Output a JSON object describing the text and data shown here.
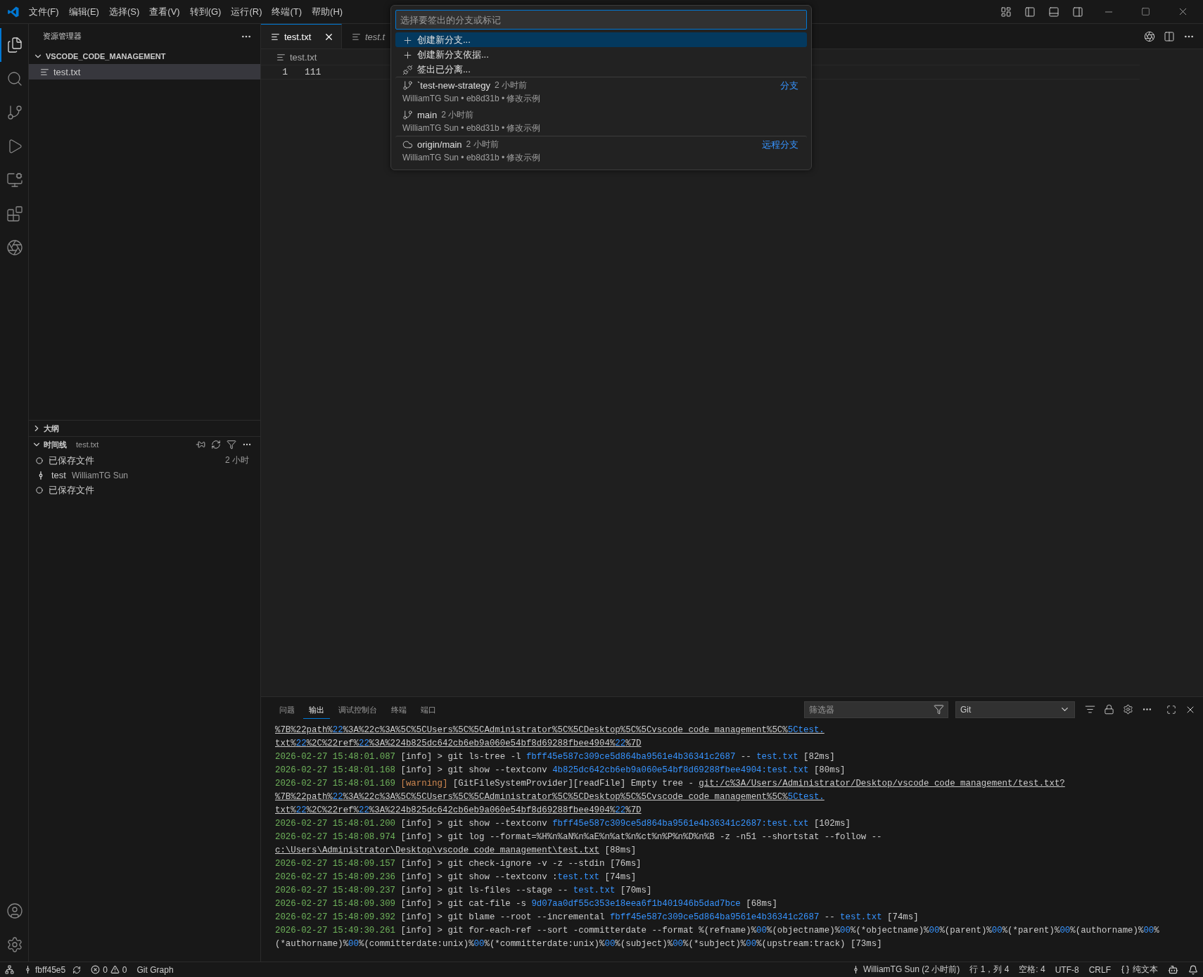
{
  "menu_bar": {
    "items": [
      "文件(F)",
      "编辑(E)",
      "选择(S)",
      "查看(V)",
      "转到(G)",
      "运行(R)",
      "终端(T)",
      "帮助(H)"
    ]
  },
  "activity_bar": {
    "items": [
      {
        "kind": "explorer",
        "selected": true
      },
      {
        "kind": "search",
        "selected": false
      },
      {
        "kind": "scm",
        "selected": false
      },
      {
        "kind": "debug",
        "selected": false
      },
      {
        "kind": "remote",
        "selected": false
      },
      {
        "kind": "extensions",
        "selected": false
      },
      {
        "kind": "assistant",
        "selected": false
      }
    ],
    "bottom": [
      {
        "kind": "account"
      },
      {
        "kind": "settings"
      }
    ]
  },
  "sidebar": {
    "title": "资源管理器",
    "folder": {
      "name": "VSCODE_CODE_MANAGEMENT",
      "expanded": true,
      "files": [
        {
          "name": "test.txt",
          "selected": true
        }
      ]
    },
    "sections": [
      {
        "title": "大纲",
        "expanded": false
      },
      {
        "title": "时间线",
        "subtitle": "test.txt",
        "expanded": true,
        "items": [
          {
            "kind": "save",
            "label": "已保存文件",
            "time": "2 小时"
          },
          {
            "kind": "commit",
            "label": "test",
            "author": "WilliamTG Sun"
          },
          {
            "kind": "save",
            "label": "已保存文件"
          }
        ]
      }
    ]
  },
  "editor": {
    "tabs": [
      {
        "label": "test.txt",
        "selected": true
      },
      {
        "label": "test.t",
        "selected": false
      }
    ],
    "breadcrumb": "test.txt",
    "lines": [
      {
        "number": "1",
        "text": "111"
      }
    ]
  },
  "quick_pick": {
    "placeholder": "选择要签出的分支或标记",
    "items": [
      {
        "kind": "create",
        "label": "创建新分支...",
        "selected": true
      },
      {
        "kind": "create",
        "label": "创建新分支依据...",
        "selected": false
      },
      {
        "kind": "detach",
        "label": "签出已分离...",
        "selected": false
      },
      {
        "kind": "branch",
        "label": "`test-new-strategy",
        "time": "2 小时前",
        "detail": "WilliamTG Sun • eb8d31b • 修改示例",
        "group": "分支",
        "selected": false
      },
      {
        "kind": "branch",
        "label": "main",
        "time": "2 小时前",
        "detail": "WilliamTG Sun • eb8d31b • 修改示例",
        "selected": false
      },
      {
        "kind": "remote",
        "label": "origin/main",
        "time": "2 小时前",
        "detail": "WilliamTG Sun • eb8d31b • 修改示例",
        "group": "远程分支",
        "selected": false
      }
    ]
  },
  "panel": {
    "tabs": [
      {
        "label": "问题",
        "selected": false
      },
      {
        "label": "输出",
        "selected": true
      },
      {
        "label": "调试控制台",
        "selected": false
      },
      {
        "label": "终端",
        "selected": false
      },
      {
        "label": "端口",
        "selected": false
      }
    ],
    "filter": {
      "placeholder": "筛选器"
    },
    "channel": "Git",
    "lines": [
      [
        {
          "kind": "link",
          "text": "%7B%22path%"
        },
        {
          "kind": "linkhash",
          "text": "22"
        },
        {
          "kind": "link",
          "text": "%3A%22c%3A%5C%5CUsers%5C%5CAdministrator%5C%5CDesktop%5C%5Cvscode_code_management%5C%"
        },
        {
          "kind": "linkhash",
          "text": "5Ctest."
        }
      ],
      [
        {
          "kind": "link",
          "text": "txt%"
        },
        {
          "kind": "linkhash",
          "text": "22"
        },
        {
          "kind": "link",
          "text": "%2C%22ref%"
        },
        {
          "kind": "linkhash",
          "text": "22"
        },
        {
          "kind": "link",
          "text": "%3A%224b825dc642cb6eb9a060e54bf8d69288fbee4904%"
        },
        {
          "kind": "linkhash",
          "text": "22"
        },
        {
          "kind": "link",
          "text": "%7D"
        }
      ],
      [
        {
          "kind": "time",
          "text": "2026-02-27 15:48:01.087"
        },
        {
          "kind": "tag",
          "text": " [info]"
        },
        {
          "kind": "plain",
          "text": " > git ls-tree -l "
        },
        {
          "kind": "hash",
          "text": "fbff45e587c309ce5d864ba9561e4b36341c2687"
        },
        {
          "kind": "plain",
          "text": " -- "
        },
        {
          "kind": "hash",
          "text": "test.txt"
        },
        {
          "kind": "plain",
          "text": " [82ms]"
        }
      ],
      [
        {
          "kind": "time",
          "text": "2026-02-27 15:48:01.168"
        },
        {
          "kind": "tag",
          "text": " [info]"
        },
        {
          "kind": "plain",
          "text": " > git show --textconv "
        },
        {
          "kind": "hash",
          "text": "4b825dc642cb6eb9a060e54bf8d69288fbee4904:test.txt"
        },
        {
          "kind": "plain",
          "text": " [80ms]"
        }
      ],
      [
        {
          "kind": "time",
          "text": "2026-02-27 15:48:01.169"
        },
        {
          "kind": "warn",
          "text": " [warning]"
        },
        {
          "kind": "plain",
          "text": " [GitFileSystemProvider][readFile] Empty tree - "
        },
        {
          "kind": "link",
          "text": "git:/c%3A/Users/Administrator/Desktop/vscode_code_management/test.txt?"
        }
      ],
      [
        {
          "kind": "link",
          "text": "%7B%22path%"
        },
        {
          "kind": "linkhash",
          "text": "22"
        },
        {
          "kind": "link",
          "text": "%3A%22c%3A%5C%5CUsers%5C%5CAdministrator%5C%5CDesktop%5C%5Cvscode_code_management%5C%"
        },
        {
          "kind": "linkhash",
          "text": "5Ctest."
        }
      ],
      [
        {
          "kind": "link",
          "text": "txt%"
        },
        {
          "kind": "linkhash",
          "text": "22"
        },
        {
          "kind": "link",
          "text": "%2C%22ref%"
        },
        {
          "kind": "linkhash",
          "text": "22"
        },
        {
          "kind": "link",
          "text": "%3A%224b825dc642cb6eb9a060e54bf8d69288fbee4904%"
        },
        {
          "kind": "linkhash",
          "text": "22"
        },
        {
          "kind": "link",
          "text": "%7D"
        }
      ],
      [
        {
          "kind": "time",
          "text": "2026-02-27 15:48:01.200"
        },
        {
          "kind": "tag",
          "text": " [info]"
        },
        {
          "kind": "plain",
          "text": " > git show --textconv "
        },
        {
          "kind": "hash",
          "text": "fbff45e587c309ce5d864ba9561e4b36341c2687:test.txt"
        },
        {
          "kind": "plain",
          "text": " [102ms]"
        }
      ],
      [
        {
          "kind": "time",
          "text": "2026-02-27 15:48:08.974"
        },
        {
          "kind": "tag",
          "text": " [info]"
        },
        {
          "kind": "plain",
          "text": " > git log --format=%H%n%aN%n%aE%n%at%n%ct%n%P%n%D%n%B -z -n51 --shortstat --follow --"
        }
      ],
      [
        {
          "kind": "link",
          "text": "c:\\Users\\Administrator\\Desktop\\vscode_code_management\\test.txt"
        },
        {
          "kind": "plain",
          "text": " [88ms]"
        }
      ],
      [
        {
          "kind": "time",
          "text": "2026-02-27 15:48:09.157"
        },
        {
          "kind": "tag",
          "text": " [info]"
        },
        {
          "kind": "plain",
          "text": " > git check-ignore -v -z --stdin [76ms]"
        }
      ],
      [
        {
          "kind": "time",
          "text": "2026-02-27 15:48:09.236"
        },
        {
          "kind": "tag",
          "text": " [info]"
        },
        {
          "kind": "plain",
          "text": " > git show --textconv :"
        },
        {
          "kind": "hash",
          "text": "test.txt"
        },
        {
          "kind": "plain",
          "text": " [74ms]"
        }
      ],
      [
        {
          "kind": "time",
          "text": "2026-02-27 15:48:09.237"
        },
        {
          "kind": "tag",
          "text": " [info]"
        },
        {
          "kind": "plain",
          "text": " > git ls-files --stage -- "
        },
        {
          "kind": "hash",
          "text": "test.txt"
        },
        {
          "kind": "plain",
          "text": " [70ms]"
        }
      ],
      [
        {
          "kind": "time",
          "text": "2026-02-27 15:48:09.309"
        },
        {
          "kind": "tag",
          "text": " [info]"
        },
        {
          "kind": "plain",
          "text": " > git cat-file -s "
        },
        {
          "kind": "hash",
          "text": "9d07aa0df55c353e18eea6f1b401946b5dad7bce"
        },
        {
          "kind": "plain",
          "text": " [68ms]"
        }
      ],
      [
        {
          "kind": "time",
          "text": "2026-02-27 15:48:09.392"
        },
        {
          "kind": "tag",
          "text": " [info]"
        },
        {
          "kind": "plain",
          "text": " > git blame --root --incremental "
        },
        {
          "kind": "hash",
          "text": "fbff45e587c309ce5d864ba9561e4b36341c2687"
        },
        {
          "kind": "plain",
          "text": " -- "
        },
        {
          "kind": "hash",
          "text": "test.txt"
        },
        {
          "kind": "plain",
          "text": " [74ms]"
        }
      ],
      [
        {
          "kind": "time",
          "text": "2026-02-27 15:49:30.261"
        },
        {
          "kind": "tag",
          "text": " [info]"
        },
        {
          "kind": "plain",
          "text": " > git for-each-ref --sort -committerdate --format %(refname)%"
        },
        {
          "kind": "hash",
          "text": "00"
        },
        {
          "kind": "plain",
          "text": "%(objectname)%"
        },
        {
          "kind": "hash",
          "text": "00"
        },
        {
          "kind": "plain",
          "text": "%(*objectname)%"
        },
        {
          "kind": "hash",
          "text": "00"
        },
        {
          "kind": "plain",
          "text": "%(parent)%"
        },
        {
          "kind": "hash",
          "text": "00"
        },
        {
          "kind": "plain",
          "text": "%(*parent)%"
        },
        {
          "kind": "hash",
          "text": "00"
        },
        {
          "kind": "plain",
          "text": "%(authorname)%"
        },
        {
          "kind": "hash",
          "text": "00"
        },
        {
          "kind": "plain",
          "text": "%"
        }
      ],
      [
        {
          "kind": "plain",
          "text": "(*authorname)%"
        },
        {
          "kind": "hash",
          "text": "00"
        },
        {
          "kind": "plain",
          "text": "%(committerdate:unix)%"
        },
        {
          "kind": "hash",
          "text": "00"
        },
        {
          "kind": "plain",
          "text": "%(*committerdate:unix)%"
        },
        {
          "kind": "hash",
          "text": "00"
        },
        {
          "kind": "plain",
          "text": "%(subject)%"
        },
        {
          "kind": "hash",
          "text": "00"
        },
        {
          "kind": "plain",
          "text": "%(*subject)%"
        },
        {
          "kind": "hash",
          "text": "00"
        },
        {
          "kind": "plain",
          "text": "%(upstream:track) [73ms]"
        }
      ]
    ]
  },
  "status_bar": {
    "branch": "fbff45e5",
    "errors": "0",
    "warnings": "0",
    "extension": "Git Graph",
    "blame": "WilliamTG Sun (2 小时前)",
    "position": "行 1，列 4",
    "spaces": "空格: 4",
    "encoding": "UTF-8",
    "eol": "CRLF",
    "language": "纯文本"
  }
}
